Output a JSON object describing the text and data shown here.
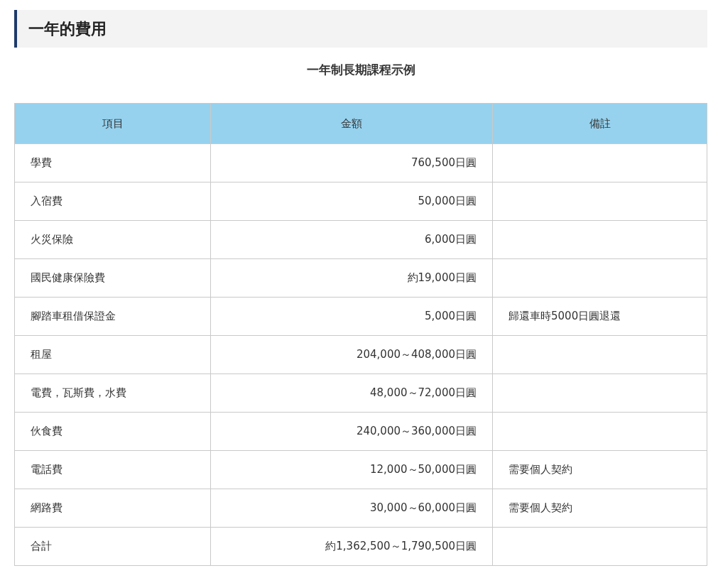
{
  "heading": "一年的費用",
  "subtitle": "一年制長期課程示例",
  "table": {
    "columns": [
      "項目",
      "金額",
      "備註"
    ],
    "rows": [
      [
        "學費",
        "760,500日圓",
        ""
      ],
      [
        "入宿費",
        "50,000日圓",
        ""
      ],
      [
        "火災保險",
        "6,000日圓",
        ""
      ],
      [
        "國民健康保險費",
        "約19,000日圓",
        ""
      ],
      [
        "腳踏車租借保證金",
        "5,000日圓",
        "歸還車時5000日圓退還"
      ],
      [
        "租屋",
        "204,000～408,000日圓",
        ""
      ],
      [
        "電費，瓦斯費，水費",
        "48,000～72,000日圓",
        ""
      ],
      [
        "伙食費",
        "240,000～360,000日圓",
        ""
      ],
      [
        "電話費",
        "12,000～50,000日圓",
        "需要個人契約"
      ],
      [
        "網路費",
        "30,000～60,000日圓",
        "需要個人契約"
      ],
      [
        "合計",
        "約1,362,500～1,790,500日圓",
        ""
      ]
    ]
  }
}
